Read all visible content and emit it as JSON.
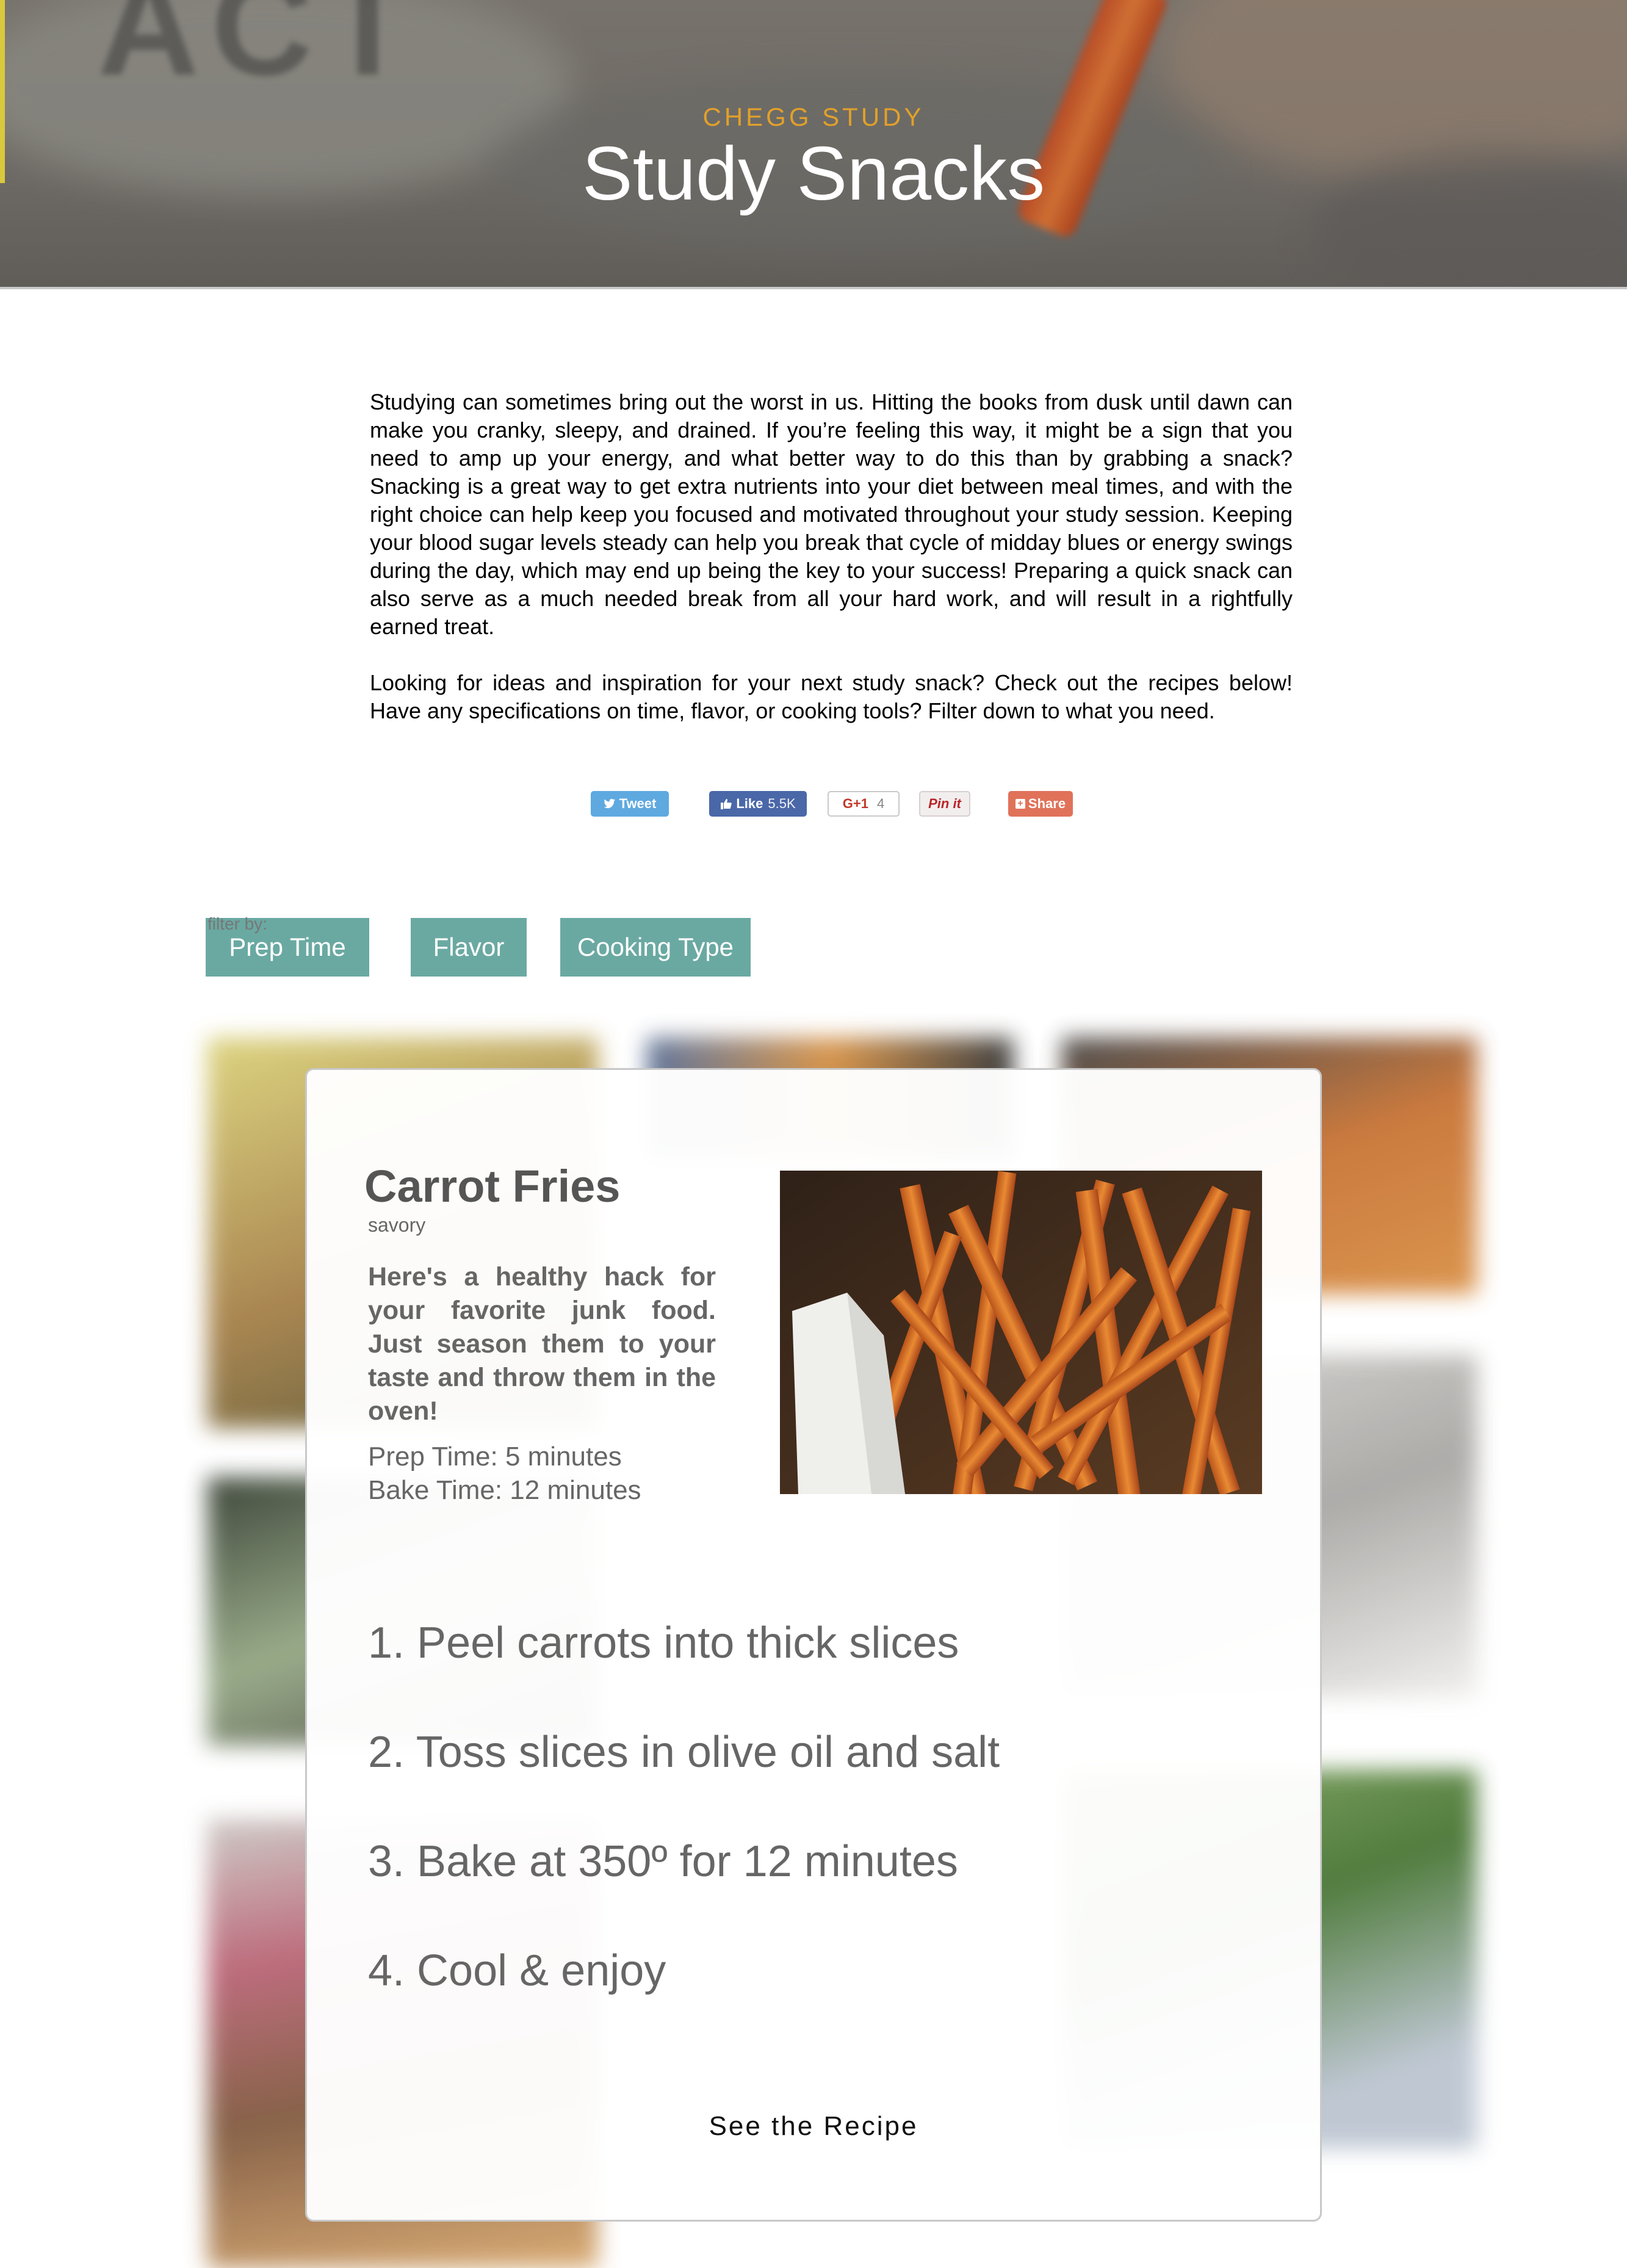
{
  "hero": {
    "eyebrow": "CHEGG STUDY",
    "title": "Study Snacks"
  },
  "intro": {
    "paragraph1": "Studying can sometimes bring out the worst in us. Hitting the books from dusk until dawn can make you cranky, sleepy, and drained. If you’re feeling this way, it might be a sign that you need to amp up your energy, and what better way to do this than by grabbing a snack? Snacking is a great way to get extra nutrients into your diet between meal times, and with the right choice can help keep you focused and motivated throughout your study session. Keeping your blood sugar levels steady can help you break that cycle of midday blues or energy swings during the day, which may end up being the key to your success! Preparing a quick snack can also serve as a much needed break from all your hard work, and will result in a rightfully earned treat.",
    "paragraph2": "Looking for ideas and inspiration for your next study snack? Check out the recipes below! Have any specifications on time, flavor, or cooking tools? Filter down to what you need."
  },
  "share": {
    "tweet": "Tweet",
    "like": "Like",
    "like_count": "5.5K",
    "gplus": "G+1",
    "gplus_count": "4",
    "pin": "Pin it",
    "share": "Share"
  },
  "filter": {
    "label": "filter by:",
    "buttons": [
      "Prep Time",
      "Flavor",
      "Cooking Type"
    ]
  },
  "recipe": {
    "title": "Carrot Fries",
    "tag": "savory",
    "description": "Here's a healthy hack for your favorite junk food. Just season them to your taste and throw them in the oven!",
    "prep_time": "Prep Time: 5 minutes",
    "bake_time": "Bake Time: 12 minutes",
    "steps": [
      "1. Peel carrots into thick slices",
      "2. Toss slices in olive oil and salt",
      "3. Bake at 350º for 12 minutes",
      "4. Cool & enjoy"
    ],
    "cta": "See the Recipe"
  },
  "colors": {
    "accent_teal": "#6aa9a2",
    "eyebrow_orange": "#e1a02b",
    "twitter": "#5ea9e0",
    "facebook": "#4a67a8",
    "share": "#e0725a"
  }
}
